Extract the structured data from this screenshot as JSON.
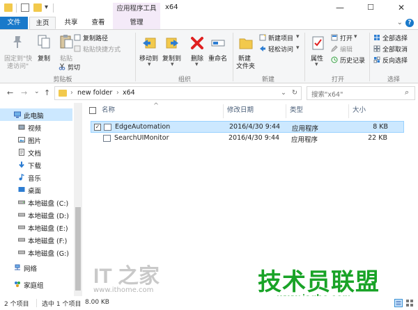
{
  "window": {
    "context_tab_title": "应用程序工具",
    "title": "x64",
    "minimize": "—",
    "maximize": "☐",
    "close": "✕"
  },
  "quick_access": {
    "dropdown": "▾"
  },
  "tabs": {
    "file": "文件",
    "home": "主页",
    "share": "共享",
    "view": "查看",
    "manage": "管理",
    "expand": "⌄",
    "help": "?"
  },
  "ribbon": {
    "clipboard": {
      "pin": "固定到\"快",
      "pin2": "速访问\"",
      "copy": "复制",
      "paste": "粘贴",
      "copy_path": "复制路径",
      "paste_shortcut": "粘贴快捷方式",
      "cut": "剪切",
      "label": "剪贴板"
    },
    "organize": {
      "move_to": "移动到",
      "copy_to": "复制到",
      "delete": "删除",
      "rename": "重命名",
      "label": "组织"
    },
    "new": {
      "new_folder": "新建",
      "new_folder2": "文件夹",
      "new_item": "新建项目",
      "easy_access": "轻松访问",
      "label": "新建"
    },
    "open": {
      "properties": "属性",
      "open": "打开",
      "edit": "编辑",
      "history": "历史记录",
      "label": "打开"
    },
    "select": {
      "select_all": "全部选择",
      "select_none": "全部取消",
      "invert": "反向选择",
      "label": "选择"
    }
  },
  "navigation": {
    "back": "←",
    "forward": "→",
    "recent": "⌄",
    "up": "↑",
    "path": [
      "new folder",
      "x64"
    ],
    "path_sep": "›",
    "path_dropdown": "⌄",
    "refresh": "↻",
    "search_placeholder": "搜索\"x64\"",
    "search_icon_glyph": "⌕"
  },
  "nav_pane": {
    "items": [
      {
        "label": "此电脑",
        "icon": "computer-icon",
        "selected": true
      },
      {
        "label": "视频",
        "icon": "video-folder-icon"
      },
      {
        "label": "图片",
        "icon": "pictures-folder-icon"
      },
      {
        "label": "文档",
        "icon": "documents-folder-icon"
      },
      {
        "label": "下载",
        "icon": "downloads-folder-icon"
      },
      {
        "label": "音乐",
        "icon": "music-folder-icon"
      },
      {
        "label": "桌面",
        "icon": "desktop-folder-icon"
      },
      {
        "label": "本地磁盘 (C:)",
        "icon": "drive-icon"
      },
      {
        "label": "本地磁盘 (D:)",
        "icon": "drive-icon"
      },
      {
        "label": "本地磁盘 (E:)",
        "icon": "drive-icon"
      },
      {
        "label": "本地磁盘 (F:)",
        "icon": "drive-icon"
      },
      {
        "label": "本地磁盘 (G:)",
        "icon": "drive-icon"
      },
      {
        "label": "网络",
        "icon": "network-icon"
      },
      {
        "label": "家庭组",
        "icon": "homegroup-icon"
      }
    ]
  },
  "file_list": {
    "columns": {
      "name": "名称",
      "date": "修改日期",
      "type": "类型",
      "size": "大小"
    },
    "sort_indicator": "^",
    "rows": [
      {
        "name": "EdgeAutomation",
        "date": "2016/4/30 9:44",
        "type": "应用程序",
        "size": "8 KB",
        "selected": true,
        "check": "✓"
      },
      {
        "name": "SearchUIMonitor",
        "date": "2016/4/30 9:44",
        "type": "应用程序",
        "size": "22 KB",
        "selected": false,
        "check": ""
      }
    ]
  },
  "status": {
    "count": "2 个项目",
    "selection": "选中 1 个项目",
    "size": "8.00 KB"
  },
  "watermarks": {
    "ithome_logo": "IT 之家",
    "ithome_url": "www.ithome.com",
    "jsgho_logo": "技术员联盟",
    "jsgho_url": "www.jsgho.com"
  }
}
